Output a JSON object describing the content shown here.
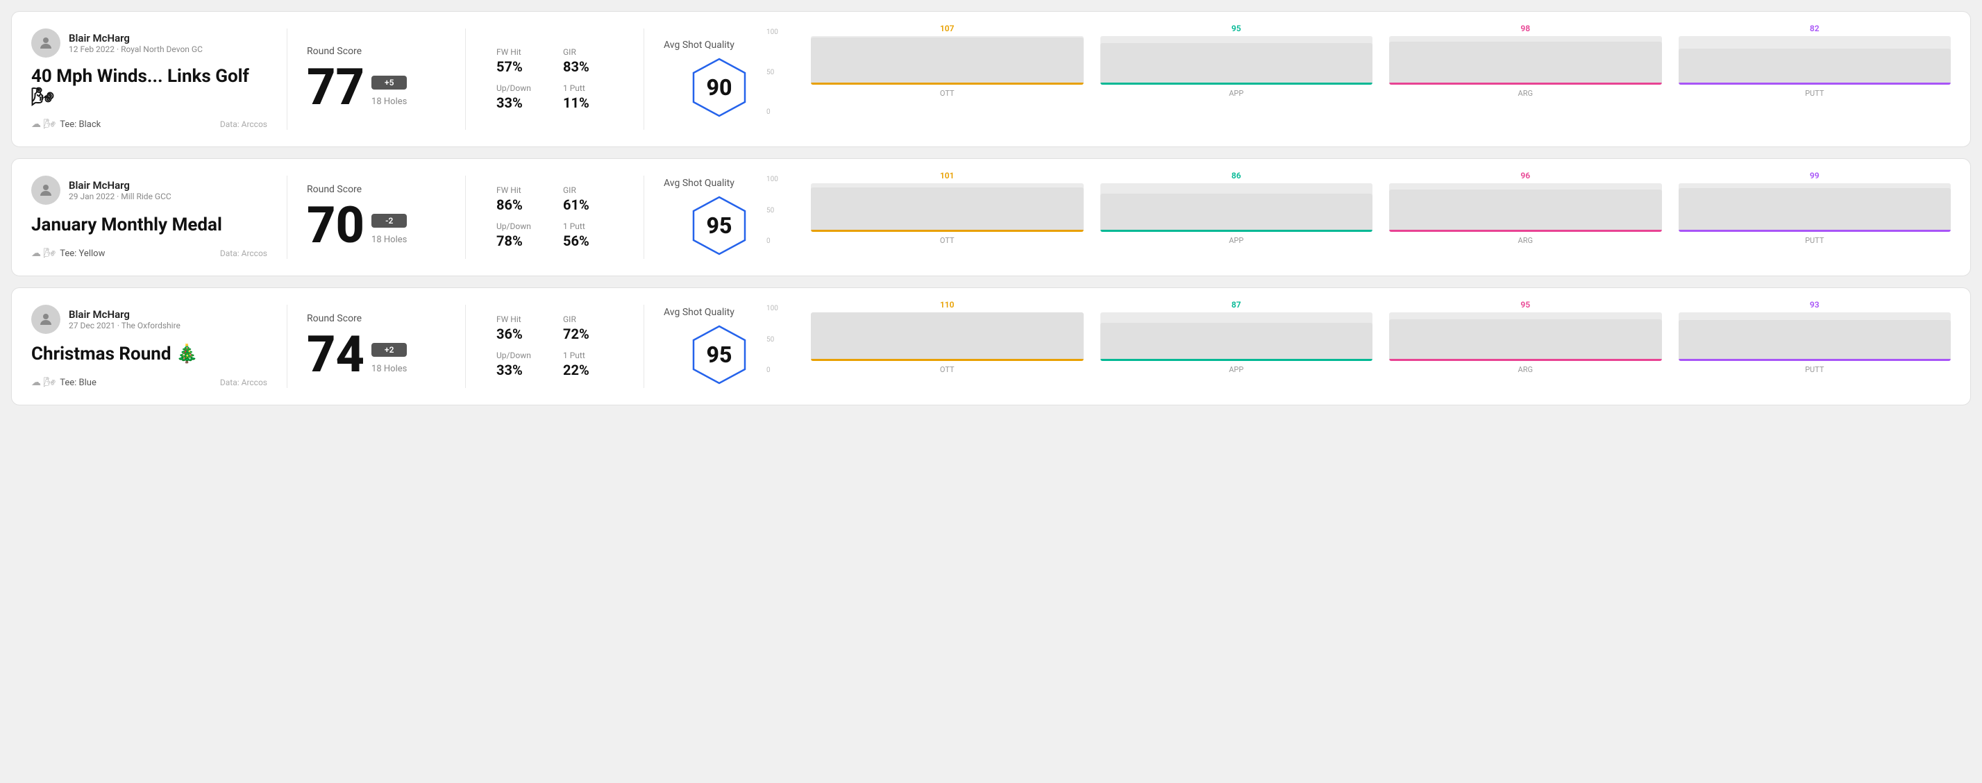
{
  "rounds": [
    {
      "id": "round-1",
      "user": {
        "name": "Blair McHarg",
        "date": "12 Feb 2022 · Royal North Devon GC"
      },
      "title": "40 Mph Winds... Links Golf 🌬",
      "tee": "Black",
      "dataSource": "Data: Arccos",
      "score": {
        "label": "Round Score",
        "value": "77",
        "badge": "+5",
        "holes": "18 Holes"
      },
      "stats": {
        "fwHit": {
          "label": "FW Hit",
          "value": "57%"
        },
        "gir": {
          "label": "GIR",
          "value": "83%"
        },
        "upDown": {
          "label": "Up/Down",
          "value": "33%"
        },
        "onePutt": {
          "label": "1 Putt",
          "value": "11%"
        }
      },
      "quality": {
        "label": "Avg Shot Quality",
        "score": "90"
      },
      "chart": {
        "bars": [
          {
            "label": "OTT",
            "value": 107,
            "color": "#e8a000",
            "maxVal": 110
          },
          {
            "label": "APP",
            "value": 95,
            "color": "#00b894",
            "maxVal": 110
          },
          {
            "label": "ARG",
            "value": 98,
            "color": "#e84393",
            "maxVal": 110
          },
          {
            "label": "PUTT",
            "value": 82,
            "color": "#a855f7",
            "maxVal": 110
          }
        ],
        "yLabels": [
          "100",
          "50",
          "0"
        ]
      }
    },
    {
      "id": "round-2",
      "user": {
        "name": "Blair McHarg",
        "date": "29 Jan 2022 · Mill Ride GCC"
      },
      "title": "January Monthly Medal",
      "tee": "Yellow",
      "dataSource": "Data: Arccos",
      "score": {
        "label": "Round Score",
        "value": "70",
        "badge": "-2",
        "holes": "18 Holes"
      },
      "stats": {
        "fwHit": {
          "label": "FW Hit",
          "value": "86%"
        },
        "gir": {
          "label": "GIR",
          "value": "61%"
        },
        "upDown": {
          "label": "Up/Down",
          "value": "78%"
        },
        "onePutt": {
          "label": "1 Putt",
          "value": "56%"
        }
      },
      "quality": {
        "label": "Avg Shot Quality",
        "score": "95"
      },
      "chart": {
        "bars": [
          {
            "label": "OTT",
            "value": 101,
            "color": "#e8a000",
            "maxVal": 110
          },
          {
            "label": "APP",
            "value": 86,
            "color": "#00b894",
            "maxVal": 110
          },
          {
            "label": "ARG",
            "value": 96,
            "color": "#e84393",
            "maxVal": 110
          },
          {
            "label": "PUTT",
            "value": 99,
            "color": "#a855f7",
            "maxVal": 110
          }
        ],
        "yLabels": [
          "100",
          "50",
          "0"
        ]
      }
    },
    {
      "id": "round-3",
      "user": {
        "name": "Blair McHarg",
        "date": "27 Dec 2021 · The Oxfordshire"
      },
      "title": "Christmas Round 🎄",
      "tee": "Blue",
      "dataSource": "Data: Arccos",
      "score": {
        "label": "Round Score",
        "value": "74",
        "badge": "+2",
        "holes": "18 Holes"
      },
      "stats": {
        "fwHit": {
          "label": "FW Hit",
          "value": "36%"
        },
        "gir": {
          "label": "GIR",
          "value": "72%"
        },
        "upDown": {
          "label": "Up/Down",
          "value": "33%"
        },
        "onePutt": {
          "label": "1 Putt",
          "value": "22%"
        }
      },
      "quality": {
        "label": "Avg Shot Quality",
        "score": "95"
      },
      "chart": {
        "bars": [
          {
            "label": "OTT",
            "value": 110,
            "color": "#e8a000",
            "maxVal": 115
          },
          {
            "label": "APP",
            "value": 87,
            "color": "#00b894",
            "maxVal": 115
          },
          {
            "label": "ARG",
            "value": 95,
            "color": "#e84393",
            "maxVal": 115
          },
          {
            "label": "PUTT",
            "value": 93,
            "color": "#a855f7",
            "maxVal": 115
          }
        ],
        "yLabels": [
          "100",
          "50",
          "0"
        ]
      }
    }
  ]
}
